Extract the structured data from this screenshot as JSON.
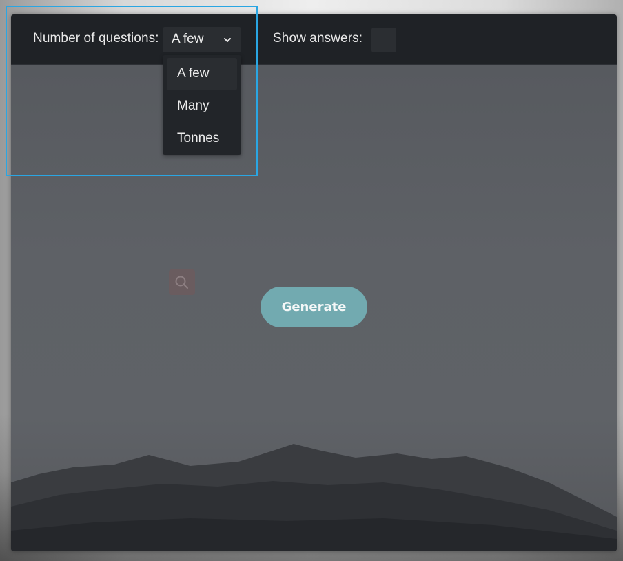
{
  "toolbar": {
    "questions_label": "Number of questions:",
    "answers_label": "Show answers:",
    "selected_quantity": "A few",
    "show_answers_checked": false
  },
  "dropdown": {
    "options": [
      {
        "label": "A few",
        "active": true
      },
      {
        "label": "Many",
        "active": false
      },
      {
        "label": "Tonnes",
        "active": false
      }
    ]
  },
  "main": {
    "generate_label": "Generate"
  },
  "icons": {
    "select_arrow": "chevron-down-icon",
    "search": "search-icon"
  },
  "colors": {
    "toolbar_bg": "#1f2226",
    "accent_button": "#72aab0",
    "search_button": "#6a5c5f",
    "highlight": "#2aa6e3"
  }
}
